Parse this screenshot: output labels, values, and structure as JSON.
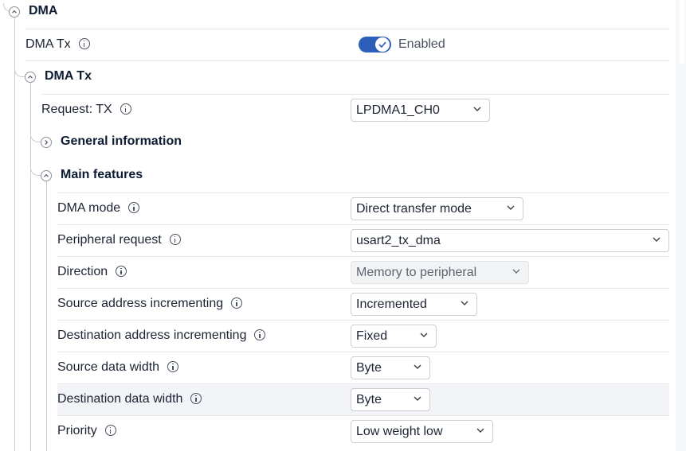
{
  "dma": {
    "title": "DMA"
  },
  "dma_tx_switch": {
    "label": "DMA Tx",
    "status": "Enabled",
    "on": true
  },
  "dma_tx_group": {
    "title": "DMA Tx"
  },
  "request": {
    "label": "Request: TX",
    "value": "LPDMA1_CH0"
  },
  "general_info": {
    "title": "General information"
  },
  "main_features": {
    "title": "Main features",
    "rows": [
      {
        "label": "DMA mode",
        "value": "Direct transfer mode"
      },
      {
        "label": "Peripheral request",
        "value": "usart2_tx_dma"
      },
      {
        "label": "Direction",
        "value": "Memory to peripheral"
      },
      {
        "label": "Source address incrementing",
        "value": "Incremented"
      },
      {
        "label": "Destination address incrementing",
        "value": "Fixed"
      },
      {
        "label": "Source data width",
        "value": "Byte"
      },
      {
        "label": "Destination data width",
        "value": "Byte"
      },
      {
        "label": "Priority",
        "value": "Low weight low"
      }
    ]
  },
  "colors": {
    "accent": "#2d5fb8",
    "highlight": "#f2f4f8"
  }
}
